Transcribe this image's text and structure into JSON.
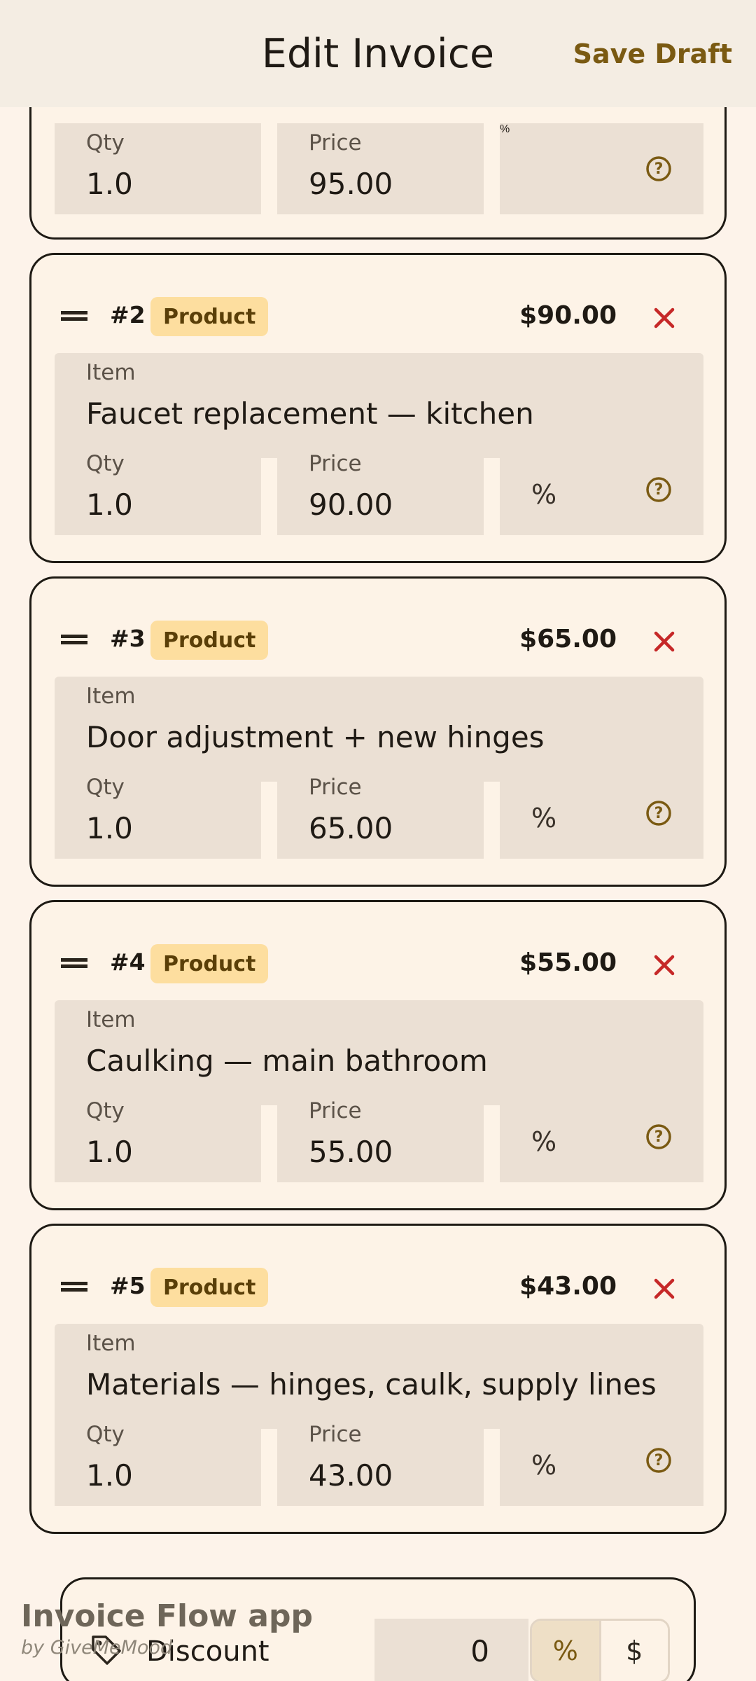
{
  "header": {
    "title": "Edit Invoice",
    "save_label": "Save Draft"
  },
  "field_labels": {
    "item": "Item",
    "qty": "Qty",
    "price": "Price",
    "discount_symbol": "%"
  },
  "top_partial_card": {
    "qty": "1.0",
    "price": "95.00"
  },
  "line_items": [
    {
      "number": "#2",
      "badge": "Product",
      "total": "$90.00",
      "item": "Faucet replacement — kitchen",
      "qty": "1.0",
      "price": "90.00"
    },
    {
      "number": "#3",
      "badge": "Product",
      "total": "$65.00",
      "item": "Door adjustment + new hinges",
      "qty": "1.0",
      "price": "65.00"
    },
    {
      "number": "#4",
      "badge": "Product",
      "total": "$55.00",
      "item": "Caulking — main bathroom",
      "qty": "1.0",
      "price": "55.00"
    },
    {
      "number": "#5",
      "badge": "Product",
      "total": "$43.00",
      "item": "Materials — hinges, caulk, supply lines",
      "qty": "1.0",
      "price": "43.00"
    }
  ],
  "discount": {
    "label": "Discount",
    "value": "0",
    "mode_percent": "%",
    "mode_dollar": "$",
    "selected_mode": "percent"
  },
  "watermark": {
    "title": "Invoice Flow app",
    "byline": "by GiveMeMood"
  },
  "icons": {
    "drag": "drag-handle-icon",
    "remove": "close-icon",
    "help": "help-circle-icon",
    "tag": "tag-icon"
  },
  "colors": {
    "accent": "#7A5A12",
    "badge_bg": "#FDDE9F",
    "remove": "#C62828",
    "field_bg": "#EBE0D4"
  }
}
